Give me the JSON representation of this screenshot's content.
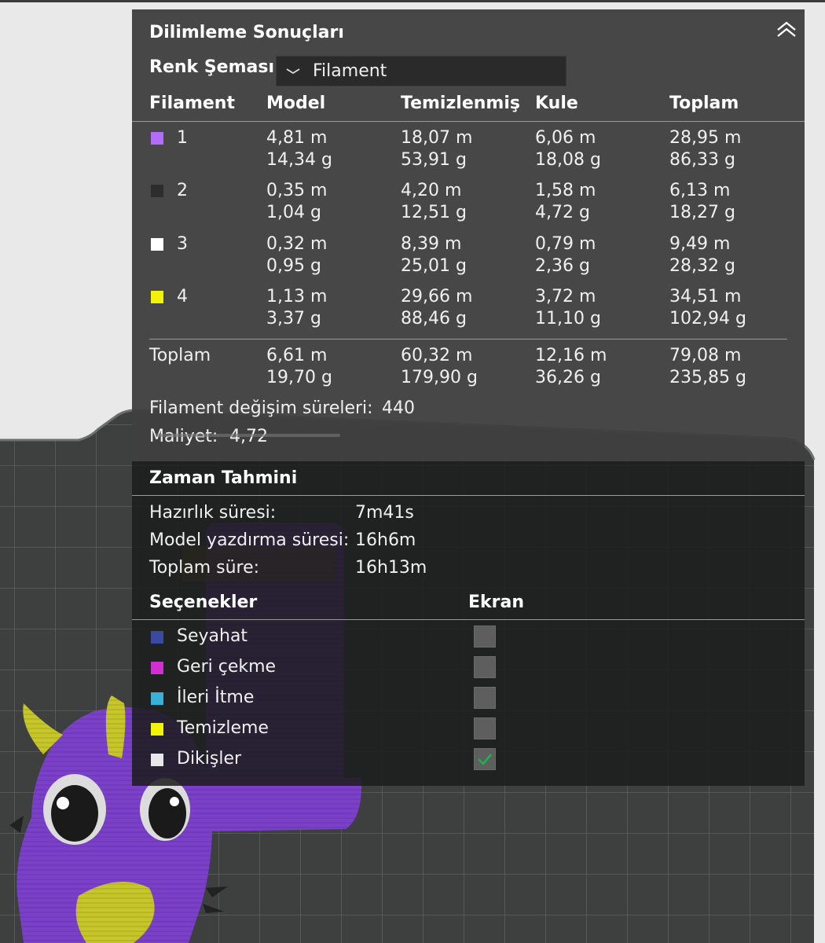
{
  "panel": {
    "title": "Dilimleme Sonuçları",
    "color_scheme_label": "Renk Şeması",
    "color_scheme_value": "Filament"
  },
  "filament_table": {
    "headers": [
      "Filament",
      "Model",
      "Temizlenmiş",
      "Kule",
      "Toplam"
    ],
    "rows": [
      {
        "id": "1",
        "color": "#b36cf7",
        "model": [
          "4,81 m",
          "14,34 g"
        ],
        "purged": [
          "18,07 m",
          "53,91 g"
        ],
        "tower": [
          "6,06 m",
          "18,08 g"
        ],
        "total": [
          "28,95 m",
          "86,33 g"
        ]
      },
      {
        "id": "2",
        "color": "#2d2d2d",
        "model": [
          "0,35 m",
          "1,04 g"
        ],
        "purged": [
          "4,20 m",
          "12,51 g"
        ],
        "tower": [
          "1,58 m",
          "4,72 g"
        ],
        "total": [
          "6,13 m",
          "18,27 g"
        ]
      },
      {
        "id": "3",
        "color": "#ffffff",
        "model": [
          "0,32 m",
          "0,95 g"
        ],
        "purged": [
          "8,39 m",
          "25,01 g"
        ],
        "tower": [
          "0,79 m",
          "2,36 g"
        ],
        "total": [
          "9,49 m",
          "28,32 g"
        ]
      },
      {
        "id": "4",
        "color": "#f2f20a",
        "model": [
          "1,13 m",
          "3,37 g"
        ],
        "purged": [
          "29,66 m",
          "88,46 g"
        ],
        "tower": [
          "3,72 m",
          "11,10 g"
        ],
        "total": [
          "34,51 m",
          "102,94 g"
        ]
      }
    ],
    "summary": {
      "label": "Toplam",
      "model": [
        "6,61 m",
        "19,70 g"
      ],
      "purged": [
        "60,32 m",
        "179,90 g"
      ],
      "tower": [
        "12,16 m",
        "36,26 g"
      ],
      "total": [
        "79,08 m",
        "235,85 g"
      ]
    }
  },
  "filament_changes": {
    "label": "Filament değişim süreleri:",
    "value": "440"
  },
  "cost": {
    "label": "Maliyet:",
    "value": "4,72"
  },
  "time_estimate": {
    "title": "Zaman Tahmini",
    "rows": [
      {
        "label": "Hazırlık süresi:",
        "value": "7m41s"
      },
      {
        "label": "Model yazdırma süresi:",
        "value": "16h6m"
      },
      {
        "label": "Toplam süre:",
        "value": "16h13m"
      }
    ]
  },
  "options": {
    "header": "Seçenekler",
    "display_header": "Ekran",
    "items": [
      {
        "label": "Seyahat",
        "color": "#3a4aa0",
        "checked": false
      },
      {
        "label": "Geri çekme",
        "color": "#d22fd2",
        "checked": false
      },
      {
        "label": "İleri İtme",
        "color": "#3ab0d6",
        "checked": false
      },
      {
        "label": "Temizleme",
        "color": "#f2f20a",
        "checked": false
      },
      {
        "label": "Dikişler",
        "color": "#e8e8e8",
        "checked": true
      }
    ]
  },
  "colors": {
    "accent_check": "#19b34a",
    "bed": "#3c3f3e",
    "model_purple": "#7a3fc4",
    "model_yellow": "#c9c82a"
  }
}
